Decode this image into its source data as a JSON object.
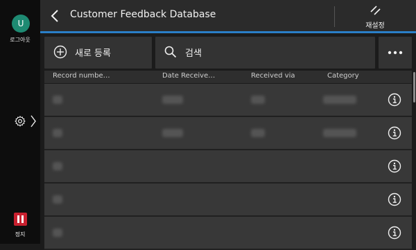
{
  "sidebar": {
    "avatar_initial": "U",
    "logout_label": "로그아웃",
    "stop_label": "정지"
  },
  "header": {
    "title": "Customer Feedback Database",
    "reset_label": "재설정",
    "accent_color": "#2a7fc8"
  },
  "toolbar": {
    "new_label": "새로 등록",
    "search_label": "검색"
  },
  "table": {
    "columns": [
      "Record numbe…",
      "Date Receive…",
      "Received via",
      "Category"
    ]
  }
}
